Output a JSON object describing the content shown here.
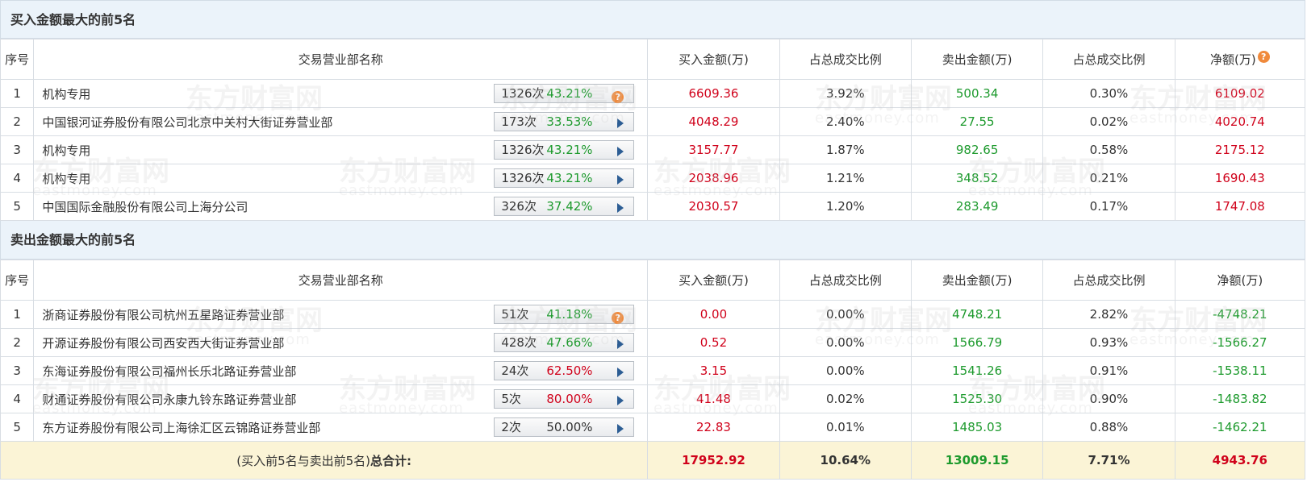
{
  "buy_section": {
    "title": "买入金额最大的前5名",
    "headers": [
      "序号",
      "交易营业部名称",
      "买入金额(万)",
      "占总成交比例",
      "卖出金额(万)",
      "占总成交比例",
      "净额(万)"
    ],
    "rows": [
      {
        "no": "1",
        "name": "机构专用",
        "count": "1326次",
        "pct": "43.21%",
        "pct_color": "green",
        "icon": "question-icon",
        "buy": "6609.36",
        "buy_ratio": "3.92%",
        "sell": "500.34",
        "sell_ratio": "0.30%",
        "net": "6109.02"
      },
      {
        "no": "2",
        "name": "中国银河证券股份有限公司北京中关村大街证券营业部",
        "count": "173次",
        "pct": "33.53%",
        "pct_color": "green",
        "icon": "arrow-right-icon",
        "buy": "4048.29",
        "buy_ratio": "2.40%",
        "sell": "27.55",
        "sell_ratio": "0.02%",
        "net": "4020.74"
      },
      {
        "no": "3",
        "name": "机构专用",
        "count": "1326次",
        "pct": "43.21%",
        "pct_color": "green",
        "icon": "arrow-right-icon",
        "buy": "3157.77",
        "buy_ratio": "1.87%",
        "sell": "982.65",
        "sell_ratio": "0.58%",
        "net": "2175.12"
      },
      {
        "no": "4",
        "name": "机构专用",
        "count": "1326次",
        "pct": "43.21%",
        "pct_color": "green",
        "icon": "arrow-right-icon",
        "buy": "2038.96",
        "buy_ratio": "1.21%",
        "sell": "348.52",
        "sell_ratio": "0.21%",
        "net": "1690.43"
      },
      {
        "no": "5",
        "name": "中国国际金融股份有限公司上海分公司",
        "count": "326次",
        "pct": "37.42%",
        "pct_color": "green",
        "icon": "arrow-right-icon",
        "buy": "2030.57",
        "buy_ratio": "1.20%",
        "sell": "283.49",
        "sell_ratio": "0.17%",
        "net": "1747.08"
      }
    ]
  },
  "sell_section": {
    "title": "卖出金额最大的前5名",
    "headers": [
      "序号",
      "交易营业部名称",
      "买入金额(万)",
      "占总成交比例",
      "卖出金额(万)",
      "占总成交比例",
      "净额(万)"
    ],
    "rows": [
      {
        "no": "1",
        "name": "浙商证券股份有限公司杭州五星路证券营业部",
        "count": "51次",
        "pct": "41.18%",
        "pct_color": "green",
        "icon": "question-icon",
        "buy": "0.00",
        "buy_ratio": "0.00%",
        "sell": "4748.21",
        "sell_ratio": "2.82%",
        "net": "-4748.21"
      },
      {
        "no": "2",
        "name": "开源证券股份有限公司西安西大街证券营业部",
        "count": "428次",
        "pct": "47.66%",
        "pct_color": "green",
        "icon": "arrow-right-icon",
        "buy": "0.52",
        "buy_ratio": "0.00%",
        "sell": "1566.79",
        "sell_ratio": "0.93%",
        "net": "-1566.27"
      },
      {
        "no": "3",
        "name": "东海证券股份有限公司福州长乐北路证券营业部",
        "count": "24次",
        "pct": "62.50%",
        "pct_color": "red",
        "icon": "arrow-right-icon",
        "buy": "3.15",
        "buy_ratio": "0.00%",
        "sell": "1541.26",
        "sell_ratio": "0.91%",
        "net": "-1538.11"
      },
      {
        "no": "4",
        "name": "财通证券股份有限公司永康九铃东路证券营业部",
        "count": "5次",
        "pct": "80.00%",
        "pct_color": "red",
        "icon": "arrow-right-icon",
        "buy": "41.48",
        "buy_ratio": "0.02%",
        "sell": "1525.30",
        "sell_ratio": "0.90%",
        "net": "-1483.82"
      },
      {
        "no": "5",
        "name": "东方证券股份有限公司上海徐汇区云锦路证券营业部",
        "count": "2次",
        "pct": "50.00%",
        "pct_color": "dark",
        "icon": "arrow-right-icon",
        "buy": "22.83",
        "buy_ratio": "0.01%",
        "sell": "1485.03",
        "sell_ratio": "0.88%",
        "net": "-1462.21"
      }
    ]
  },
  "total": {
    "label_prefix": "(买入前5名与卖出前5名)",
    "label_bold": "总合计:",
    "buy": "17952.92",
    "buy_ratio": "10.64%",
    "sell": "13009.15",
    "sell_ratio": "7.71%",
    "net": "4943.76"
  },
  "watermark": {
    "cn": "东方财富网",
    "en": "eastmoney.com"
  },
  "colors": {
    "red": "#d0021b",
    "green": "#1d9a2d",
    "header_bg": "#ebf3fa",
    "total_bg": "#fbf4d6"
  }
}
